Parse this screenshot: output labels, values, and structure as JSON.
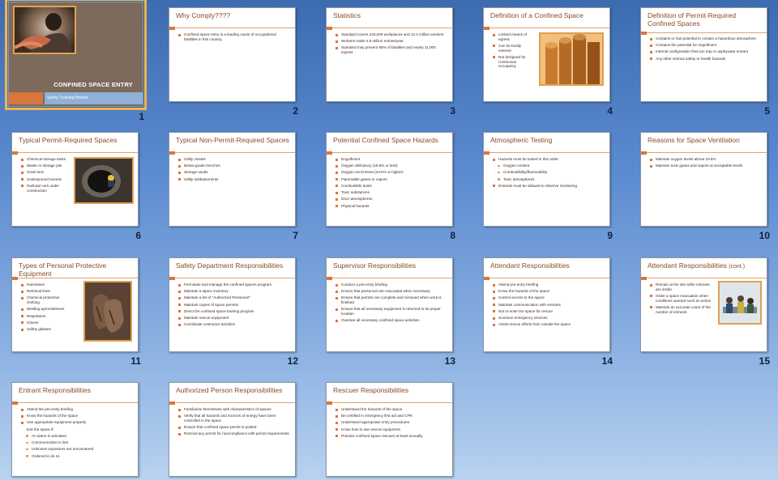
{
  "colors": {
    "accent": "#d8763c",
    "title": "#8a4a26",
    "background": "#5b8ad0",
    "selection": "#f0b44c"
  },
  "title_slide": {
    "title": "CONFINED SPACE ENTRY",
    "subtitle": "Safety Training Module"
  },
  "slides": [
    {
      "number": "1"
    },
    {
      "number": "2",
      "title": "Why Comply????",
      "bullets": [
        "Confined space entry is a leading cause of occupational fatalities in this country."
      ]
    },
    {
      "number": "3",
      "title": "Statistics",
      "bullets": [
        "Standard covers 240,000 workplaces and 12.2 million workers",
        "Workers make 4.8 million entries/year",
        "Standard may prevent 85% of fatalities and nearly 11,000 injuries"
      ]
    },
    {
      "number": "4",
      "title": "Definition of a Confined Space",
      "bullets": [
        "Limited means of egress",
        "Can be bodily entered",
        "Not designed for continuous occupancy"
      ]
    },
    {
      "number": "5",
      "title": "Definition of Permit-Required Confined Spaces",
      "bullets": [
        "Contains or has potential to contain a hazardous atmosphere",
        "Contains the potential for engulfment",
        "Internal configuration that can trap or asphyxiate entrant",
        "Any other serious safety or health hazards"
      ]
    },
    {
      "number": "6",
      "title": "Typical Permit-Required Spaces",
      "bullets": [
        "Chemical storage tanks",
        "Waste or storage pits",
        "Grain bins",
        "Underground tunnels",
        "Railroad cars under construction"
      ]
    },
    {
      "number": "7",
      "title": "Typical Non-Permit-Required Spaces",
      "bullets": [
        "Utility closets",
        "Below-grade trenches",
        "Storage vaults",
        "Utility subbasements"
      ]
    },
    {
      "number": "8",
      "title": "Potential Confined Space Hazards",
      "bullets": [
        "Engulfment",
        "Oxygen deficiency (19.5% or less)",
        "Oxygen enrichment (23.5% or higher)",
        "Flammable gases or vapors",
        "Combustible dusts",
        "Toxic substances",
        "IDLH atmospheres",
        "Physical hazards"
      ]
    },
    {
      "number": "9",
      "title": "Atmospheric Testing",
      "bullets": [
        "Hazards must be tested in this order:",
        "Oxygen content",
        "Combustibility/flammability",
        "Toxic atmospheres",
        "Entrants must be allowed to observe monitoring"
      ]
    },
    {
      "number": "10",
      "title": "Reasons for Space Ventilation",
      "bullets": [
        "Maintain oxygen levels above 19.5%",
        "Maintain toxic gases and vapors at acceptable levels"
      ]
    },
    {
      "number": "11",
      "title": "Types of Personal Protective Equipment",
      "bullets": [
        "Harnesses",
        "Retrieval lines",
        "Chemical protective clothing",
        "Welding apron/sleeves",
        "Respirators",
        "Gloves",
        "Safety glasses"
      ]
    },
    {
      "number": "12",
      "title": "Safety Department Responsibilities",
      "bullets": [
        "Formulate and manage the confined spaces program",
        "Maintain a space inventory",
        "Maintain a list of \"Authorized Personnel\"",
        "Maintain copies of space permits",
        "Direct the confined space training program",
        "Maintain rescue equipment",
        "Coordinate contractor activities"
      ]
    },
    {
      "number": "13",
      "title": "Supervisor Responsibilities",
      "bullets": [
        "Conduct a pre-entry briefing",
        "Ensure that personnel are evacuated when necessary",
        "Ensure that permits are complete and removed when work is finished",
        "Ensure that all necessary equipment is returned to its proper location",
        "Oversee all necessary confined space activities"
      ]
    },
    {
      "number": "14",
      "title": "Attendant Responsibilities",
      "bullets": [
        "Attend pre-entry briefing",
        "Know the hazards of the space",
        "Control access to the space",
        "Maintain communication with entrants",
        "Not to enter the space for rescue",
        "Summon emergency services",
        "Assist rescue efforts from outside the space"
      ]
    },
    {
      "number": "15",
      "title": "Attendant Responsibilities",
      "title_suffix": "(cont.)",
      "bullets": [
        "Remain at the site while entrants are inside",
        "Order a space evacuation when conditions warrant such an action",
        "Maintain an accurate count of the number of entrants"
      ]
    },
    {
      "number": "16",
      "title": "Entrant Responsibilities",
      "bullets": [
        "Attend the pre-entry briefing",
        "Know the hazards of the space",
        "Use appropriate equipment properly",
        "Exit the space if:",
        "An alarm is activated",
        "Communication is lost",
        "Unknown exposures are encountered",
        "Ordered to do so"
      ]
    },
    {
      "number": "17",
      "title": "Authorized Person Responsibilities",
      "bullets": [
        "Familiarize themselves with characteristics of spaces",
        "Verify that all hazards and sources of energy have been controlled in the space",
        "Ensure that confined space permit is posted",
        "Rescind any permit for noncompliance with permit requirements"
      ]
    },
    {
      "number": "18",
      "title": "Rescuer Responsibilities",
      "bullets": [
        "Understand the hazards of the space",
        "Be certified in emergency first aid and CPR",
        "Understand appropriate entry procedures",
        "Know how to use rescue equipment",
        "Practice confined space rescues at least annually"
      ]
    }
  ]
}
